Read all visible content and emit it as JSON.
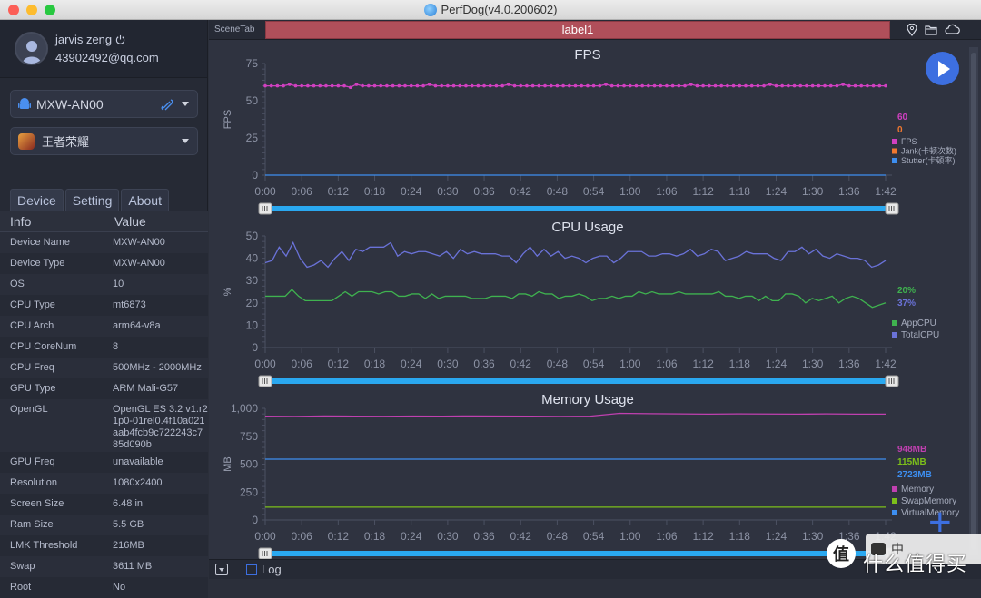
{
  "window": {
    "title": "PerfDog(v4.0.200602)"
  },
  "user": {
    "name": "jarvis zeng",
    "email": "43902492@qq.com"
  },
  "device_select": {
    "value": "MXW-AN00"
  },
  "app_select": {
    "value": "王者荣耀"
  },
  "tabs": [
    {
      "label": "Device"
    },
    {
      "label": "Setting"
    },
    {
      "label": "About"
    }
  ],
  "info_table": {
    "headers": [
      "Info",
      "Value"
    ],
    "rows": [
      {
        "key": "Device Name",
        "value": "MXW-AN00"
      },
      {
        "key": "Device Type",
        "value": "MXW-AN00"
      },
      {
        "key": "OS",
        "value": "10"
      },
      {
        "key": "CPU Type",
        "value": "mt6873"
      },
      {
        "key": "CPU Arch",
        "value": "arm64-v8a"
      },
      {
        "key": "CPU CoreNum",
        "value": "8"
      },
      {
        "key": "CPU Freq",
        "value": "500MHz - 2000MHz"
      },
      {
        "key": "GPU Type",
        "value": "ARM Mali-G57"
      },
      {
        "key": "OpenGL",
        "value": "OpenGL ES 3.2 v1.r21p0-01rel0.4f10a021aab4fcb9c722243c785d090b"
      },
      {
        "key": "GPU Freq",
        "value": "unavailable"
      },
      {
        "key": "Resolution",
        "value": "1080x2400"
      },
      {
        "key": "Screen Size",
        "value": "6.48 in"
      },
      {
        "key": "Ram Size",
        "value": "5.5 GB"
      },
      {
        "key": "LMK Threshold",
        "value": "216MB"
      },
      {
        "key": "Swap",
        "value": "3611 MB"
      },
      {
        "key": "Root",
        "value": "No"
      }
    ]
  },
  "scene": {
    "tab_label": "SceneTab",
    "label": "label1"
  },
  "bottom": {
    "log_label": "Log"
  },
  "watermark": {
    "text": "什么值得买",
    "badge": "值",
    "ime": "中"
  },
  "chart_data": [
    {
      "type": "line",
      "title": "FPS",
      "ylabel": "FPS",
      "ylim": [
        0,
        75
      ],
      "yticks": [
        0,
        25,
        50,
        75
      ],
      "xticks": [
        "0:00",
        "0:06",
        "0:12",
        "0:18",
        "0:24",
        "0:30",
        "0:36",
        "0:42",
        "0:48",
        "0:54",
        "1:00",
        "1:06",
        "1:12",
        "1:18",
        "1:24",
        "1:30",
        "1:36",
        "1:42"
      ],
      "series": [
        {
          "name": "FPS",
          "color": "#d040c0",
          "current": "60",
          "values": [
            60,
            60,
            60,
            60,
            61,
            60,
            60,
            60,
            60,
            60,
            60,
            60,
            60,
            60,
            59,
            61,
            60,
            60,
            60,
            60,
            60,
            60,
            60,
            60,
            60,
            60,
            60,
            61,
            60,
            60,
            60,
            60,
            60,
            60,
            60,
            60,
            60,
            60,
            60,
            60,
            61,
            60,
            60,
            60,
            60,
            60,
            60,
            60,
            60,
            60,
            60,
            60,
            60,
            60,
            60,
            60,
            61,
            60,
            60,
            60,
            60,
            60,
            60,
            60,
            60,
            60,
            60,
            60,
            60,
            60,
            61,
            60,
            60,
            60,
            60,
            60,
            60,
            60,
            60,
            60,
            60,
            60,
            60,
            61,
            60,
            60,
            60,
            60,
            60,
            60,
            60,
            60,
            60,
            60,
            60,
            61,
            60,
            60,
            60,
            60,
            60,
            60,
            60
          ]
        },
        {
          "name": "Jank(卡顿次数)",
          "color": "#f07830",
          "current": "0",
          "values": []
        },
        {
          "name": "Stutter(卡顿率)",
          "color": "#3d8ef0",
          "current": "",
          "values": [
            0,
            0
          ]
        }
      ]
    },
    {
      "type": "line",
      "title": "CPU Usage",
      "ylabel": "%",
      "ylim": [
        0,
        50
      ],
      "yticks": [
        0,
        10,
        20,
        30,
        40,
        50
      ],
      "xticks": [
        "0:00",
        "0:06",
        "0:12",
        "0:18",
        "0:24",
        "0:30",
        "0:36",
        "0:42",
        "0:48",
        "0:54",
        "1:00",
        "1:06",
        "1:12",
        "1:18",
        "1:24",
        "1:30",
        "1:36",
        "1:42"
      ],
      "series": [
        {
          "name": "AppCPU",
          "color": "#3fb24f",
          "current": "20%",
          "values": [
            23,
            23,
            23,
            23,
            26,
            23,
            21,
            21,
            21,
            21,
            21,
            23,
            25,
            23,
            25,
            25,
            25,
            24,
            25,
            25,
            23,
            23,
            24,
            24,
            22,
            24,
            22,
            23,
            23,
            23,
            23,
            22,
            22,
            22,
            23,
            23,
            23,
            22,
            24,
            24,
            23,
            25,
            24,
            24,
            22,
            23,
            23,
            24,
            23,
            21,
            22,
            22,
            23,
            22,
            23,
            23,
            25,
            24,
            25,
            24,
            24,
            24,
            25,
            24,
            24,
            24,
            24,
            24,
            25,
            23,
            23,
            22,
            23,
            23,
            21,
            23,
            21,
            21,
            24,
            24,
            23,
            20,
            22,
            21,
            22,
            23,
            20,
            22,
            23,
            22,
            20,
            18,
            19,
            20
          ]
        },
        {
          "name": "TotalCPU",
          "color": "#6a72d8",
          "current": "37%",
          "values": [
            38,
            39,
            45,
            41,
            47,
            40,
            36,
            37,
            39,
            36,
            40,
            43,
            39,
            44,
            43,
            45,
            45,
            45,
            47,
            41,
            43,
            42,
            43,
            43,
            42,
            41,
            43,
            40,
            44,
            42,
            43,
            42,
            42,
            42,
            41,
            41,
            38,
            42,
            45,
            41,
            44,
            41,
            43,
            40,
            41,
            40,
            38,
            40,
            41,
            41,
            38,
            40,
            43,
            43,
            43,
            41,
            41,
            42,
            42,
            41,
            42,
            44,
            41,
            42,
            44,
            43,
            39,
            40,
            41,
            43,
            42,
            42,
            42,
            40,
            39,
            43,
            43,
            45,
            42,
            44,
            41,
            40,
            42,
            41,
            40,
            40,
            39,
            36,
            37,
            39
          ]
        }
      ]
    },
    {
      "type": "line",
      "title": "Memory Usage",
      "ylabel": "MB",
      "ylim": [
        0,
        1000
      ],
      "yticks": [
        0,
        250,
        500,
        750,
        "1,000"
      ],
      "xticks": [
        "0:00",
        "0:06",
        "0:12",
        "0:18",
        "0:24",
        "0:30",
        "0:36",
        "0:42",
        "0:48",
        "0:54",
        "1:00",
        "1:06",
        "1:12",
        "1:18",
        "1:24",
        "1:30",
        "1:36",
        "1:42"
      ],
      "series": [
        {
          "name": "Memory",
          "color": "#c040b0",
          "current": "948MB",
          "values": [
            930,
            928,
            932,
            930,
            929,
            931,
            930,
            932,
            931,
            930,
            928,
            930,
            955,
            952,
            950,
            948,
            950,
            949,
            948,
            950,
            948,
            948
          ]
        },
        {
          "name": "SwapMemory",
          "color": "#7cbf1a",
          "current": "115MB",
          "values": [
            115,
            115
          ]
        },
        {
          "name": "VirtualMemory",
          "color": "#3d8ef0",
          "current": "2723MB",
          "values": [
            545,
            545
          ]
        }
      ]
    }
  ]
}
